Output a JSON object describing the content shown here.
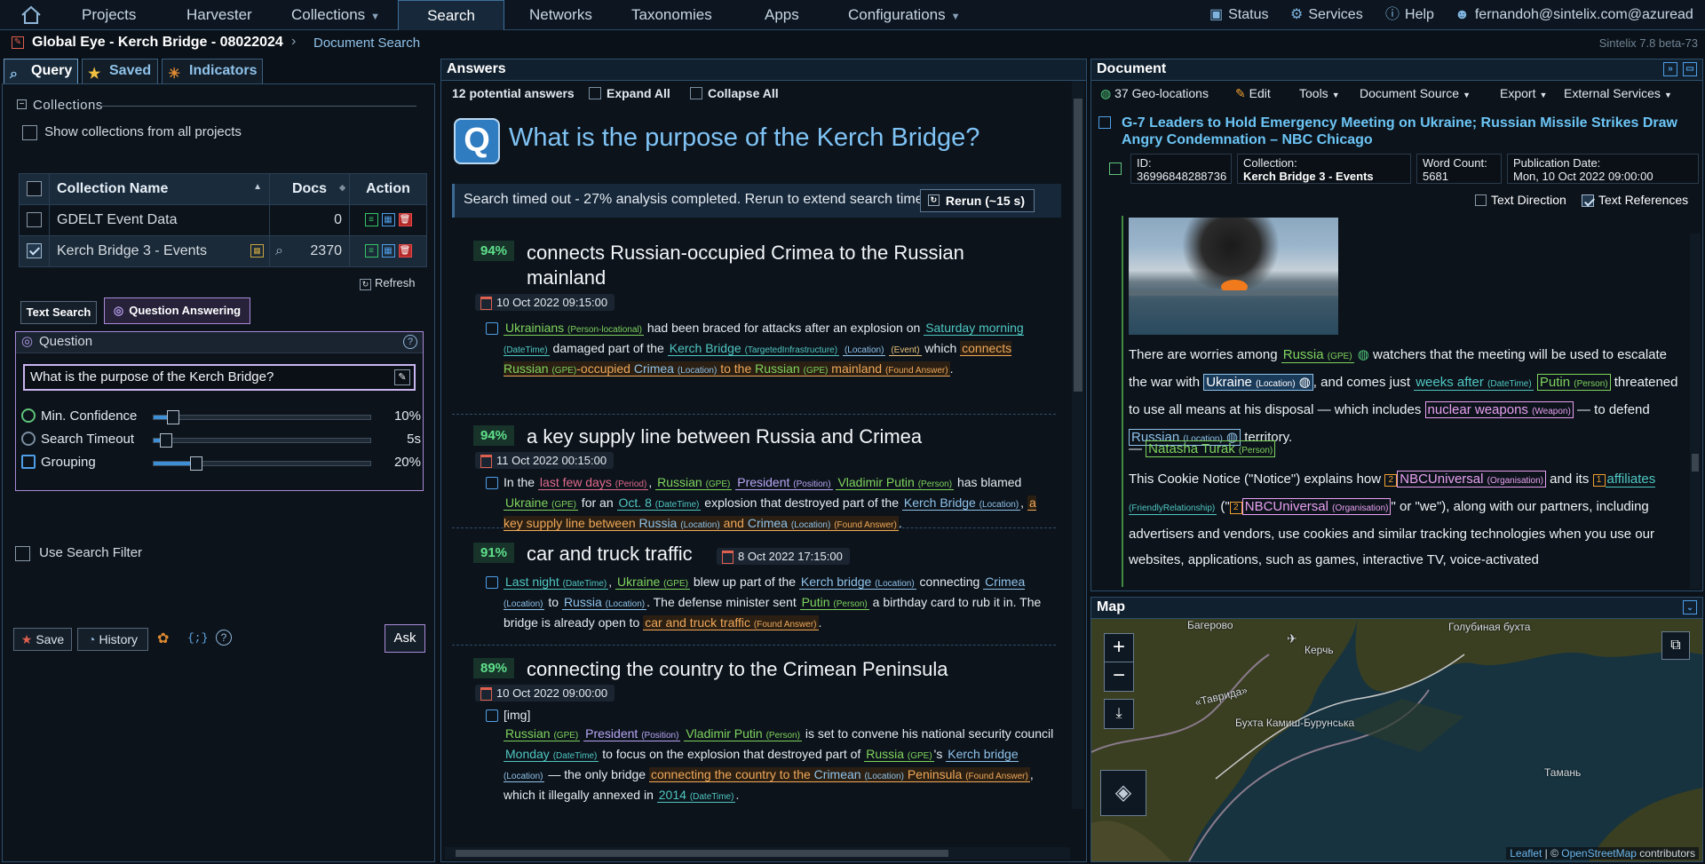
{
  "nav": {
    "items": [
      "Projects",
      "Harvester",
      "Collections",
      "Search",
      "Networks",
      "Taxonomies",
      "Apps",
      "Configurations"
    ],
    "status": "Status",
    "services": "Services",
    "help": "Help",
    "user": "fernandoh@sintelix.com@azuread"
  },
  "breadcrumb": {
    "project": "Global Eye - Kerch Bridge - 08022024",
    "page": "Document Search",
    "version": "Sintelix 7.8 beta-73"
  },
  "left": {
    "tabs": [
      "Query",
      "Saved",
      "Indicators"
    ],
    "collections_title": "Collections",
    "show_all": "Show collections from all projects",
    "table": {
      "headers": [
        "Collection Name",
        "Docs",
        "Action"
      ],
      "rows": [
        {
          "name": "GDELT Event Data",
          "docs": "0"
        },
        {
          "name": "Kerch Bridge 3 - Events",
          "docs": "2370"
        }
      ]
    },
    "refresh": "Refresh",
    "subtabs": [
      "Text Search",
      "Question Answering"
    ],
    "question_label": "Question",
    "question_value": "What is the purpose of the Kerch Bridge?",
    "sliders": [
      {
        "label": "Min. Confidence",
        "value": "10%",
        "level": 0.1
      },
      {
        "label": "Search Timeout",
        "value": "5s",
        "level": 0.05
      },
      {
        "label": "Grouping",
        "value": "20%",
        "level": 0.2
      }
    ],
    "use_filter": "Use Search Filter",
    "buttons": {
      "save": "Save",
      "history": "History",
      "braces": "{;}",
      "help": "?",
      "ask": "Ask"
    }
  },
  "answers": {
    "title": "Answers",
    "count": "12 potential answers",
    "expand": "Expand All",
    "collapse": "Collapse All",
    "question": "What is the purpose of the Kerch Bridge?",
    "q_icon": "Q",
    "timeout": "Search timed out - 27% analysis completed. Rerun to extend search time",
    "rerun": "Rerun (~15 s)",
    "items": [
      {
        "pct": "94%",
        "title": "connects Russian-occupied Crimea to the Russian mainland",
        "date": "10 Oct 2022 09:15:00"
      },
      {
        "pct": "94%",
        "title": "a key supply line between Russia and Crimea",
        "date": "11 Oct 2022 00:15:00"
      },
      {
        "pct": "91%",
        "title": "car and truck traffic",
        "date": "8 Oct 2022 17:15:00"
      },
      {
        "pct": "89%",
        "title": "connecting the country to the Crimean Peninsula",
        "date": "10 Oct 2022 09:00:00"
      }
    ]
  },
  "document": {
    "title": "Document",
    "geo": "37 Geo-locations",
    "edit": "Edit",
    "tools": "Tools",
    "source": "Document Source",
    "export": "Export",
    "external": "External Services",
    "doc_title": "G-7 Leaders to Hold Emergency Meeting on Ukraine; Russian Missile Strikes Draw Angry Condemnation – NBC Chicago",
    "meta": [
      {
        "k": "ID:",
        "v": "36996848288736"
      },
      {
        "k": "Collection:",
        "v": "Kerch Bridge 3 - Events"
      },
      {
        "k": "Word Count:",
        "v": "5681"
      },
      {
        "k": "Publication Date:",
        "v": "Mon, 10 Oct 2022 09:00:00"
      }
    ],
    "text_direction": "Text Direction",
    "text_references": "Text References"
  },
  "map": {
    "title": "Map",
    "labels": [
      "Багерово",
      "Голубиная бухта",
      "Керчь",
      "«Таврида»",
      "Бухта Камиш-Бурунська",
      "Тамань"
    ],
    "attr_leaflet": "Leaflet",
    "attr_sep": " | © ",
    "attr_osm": "OpenStreetMap",
    "attr_tail": " contributors"
  }
}
